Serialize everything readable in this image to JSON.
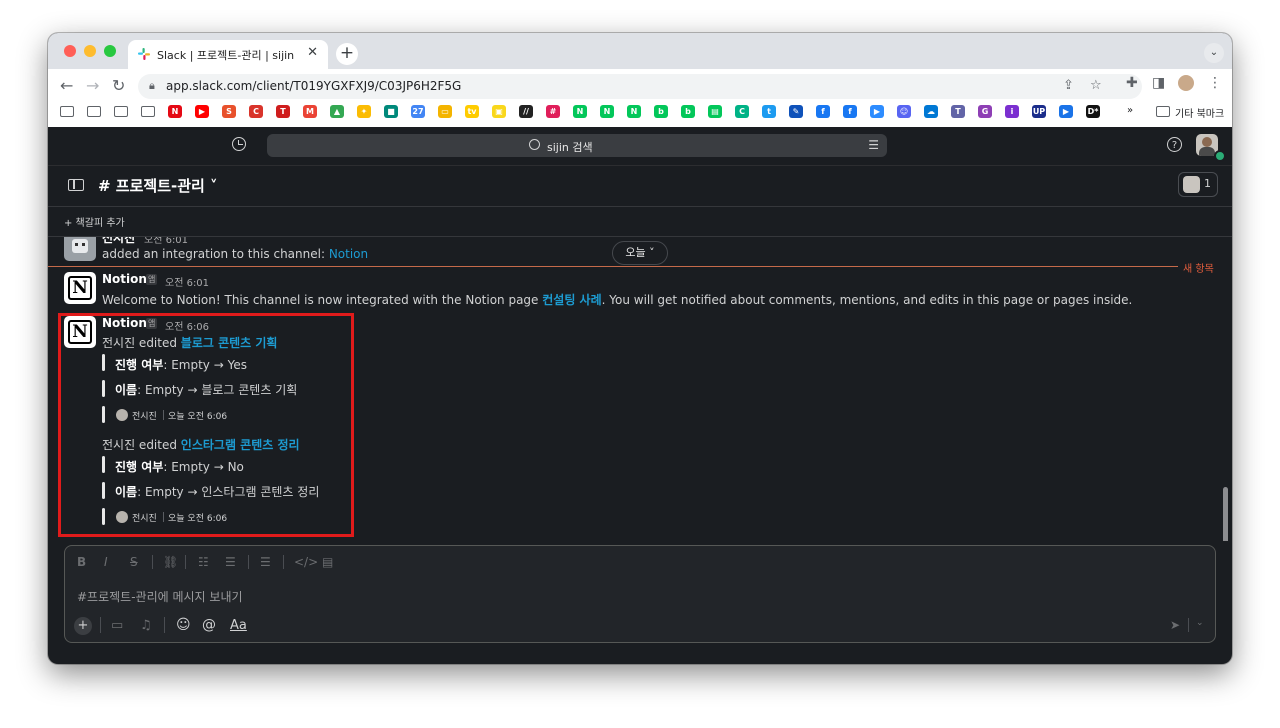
{
  "browser": {
    "tab_title": "Slack | 프로젝트-관리 | sijin",
    "new_tab": "+",
    "url": "app.slack.com/client/T019YGXFXJ9/C03JP6H2F5G",
    "other_bookmarks": "기타 북마크"
  },
  "bookmarks": {
    "items": [
      {
        "icon": "folder-icon"
      },
      {
        "icon": "folder-icon"
      },
      {
        "icon": "folder-icon"
      },
      {
        "icon": "folder-icon"
      },
      {
        "icon": "netflix-icon",
        "color": "#e50914",
        "text": "N"
      },
      {
        "icon": "youtube-icon",
        "color": "#ff0000",
        "text": "▶"
      },
      {
        "icon": "s-icon",
        "color": "#e8512c",
        "text": "S"
      },
      {
        "icon": "c-icon",
        "color": "#d9342b",
        "text": "C"
      },
      {
        "icon": "t-icon",
        "color": "#cf1d1d",
        "text": "T"
      },
      {
        "icon": "gmail-icon",
        "color": "#ea4335",
        "text": "M"
      },
      {
        "icon": "drive-icon",
        "color": "#34a853",
        "text": "▲"
      },
      {
        "icon": "photos-icon",
        "color": "#fbbc04",
        "text": "✦"
      },
      {
        "icon": "meet-icon",
        "color": "#00897b",
        "text": "■"
      },
      {
        "icon": "calendar-icon",
        "color": "#4285f4",
        "text": "27"
      },
      {
        "icon": "slides-icon",
        "color": "#f4b400",
        "text": "▭"
      },
      {
        "icon": "vod-icon",
        "color": "#ffcc00",
        "text": "tv"
      },
      {
        "icon": "tv-icon",
        "color": "#f9d71c",
        "text": "▣"
      },
      {
        "icon": "stripe-icon",
        "color": "#222222",
        "text": "//"
      },
      {
        "icon": "slack-icon",
        "color": "#e01e5a",
        "text": "#"
      },
      {
        "icon": "naver-icon",
        "color": "#03c75a",
        "text": "N"
      },
      {
        "icon": "naver-icon",
        "color": "#03c75a",
        "text": "N"
      },
      {
        "icon": "naver-icon",
        "color": "#03c75a",
        "text": "N"
      },
      {
        "icon": "blog-icon",
        "color": "#03c75a",
        "text": "b"
      },
      {
        "icon": "blog-icon",
        "color": "#03c75a",
        "text": "b"
      },
      {
        "icon": "store-icon",
        "color": "#03c75a",
        "text": "▤"
      },
      {
        "icon": "cafe-icon",
        "color": "#00b386",
        "text": "C"
      },
      {
        "icon": "twitter-icon",
        "color": "#1d9bf0",
        "text": "t"
      },
      {
        "icon": "link-icon",
        "color": "#0f52ba",
        "text": "✎"
      },
      {
        "icon": "facebook-icon",
        "color": "#1877f2",
        "text": "f"
      },
      {
        "icon": "facebook-icon",
        "color": "#1877f2",
        "text": "f"
      },
      {
        "icon": "zoom-icon",
        "color": "#2d8cff",
        "text": "▶"
      },
      {
        "icon": "discord-icon",
        "color": "#5865f2",
        "text": "☺"
      },
      {
        "icon": "onedrive-icon",
        "color": "#0078d4",
        "text": "☁"
      },
      {
        "icon": "teams-icon",
        "color": "#6264a7",
        "text": "T"
      },
      {
        "icon": "g-icon",
        "color": "#8e3fb5",
        "text": "G"
      },
      {
        "icon": "info-icon",
        "color": "#7b2fd0",
        "text": "i"
      },
      {
        "icon": "up-icon",
        "color": "#1b2d8b",
        "text": "UP"
      },
      {
        "icon": "play-icon",
        "color": "#1a73e8",
        "text": "▶"
      },
      {
        "icon": "dstar-icon",
        "color": "#111111",
        "text": "D*"
      }
    ],
    "overflow": "»"
  },
  "slack": {
    "search_placeholder": "sijin 검색",
    "help": "?",
    "channel_name": "# 프로젝트-관리 ˅",
    "member_count": "1",
    "add_bookmark": "+  책갈피 추가",
    "day_divider": "오늘 ˅",
    "new_label": "새 항목",
    "messages": [
      {
        "sender": "전시진",
        "time": "오전 6:01",
        "text_prefix": "added an integration to this channel: ",
        "link": "Notion"
      },
      {
        "sender": "Notion",
        "badge": "앱",
        "time": "오전 6:01",
        "text_prefix": "Welcome to Notion! This channel is now integrated with the Notion page ",
        "link": "컨설팅 사례",
        "text_suffix": ". You will get notified about comments, mentions, and edits in this page or pages inside."
      },
      {
        "sender": "Notion",
        "badge": "앱",
        "time": "오전 6:06",
        "edits": [
          {
            "editor_prefix": "전시진 edited ",
            "page": "블로그 콘텐츠 기획",
            "changes": [
              {
                "field": "진행 여부",
                "value": ": Empty → Yes"
              },
              {
                "field": "이름",
                "value": ": Empty → 블로그 콘텐츠 기획"
              }
            ],
            "footer_name": "전시진",
            "footer_time": "오늘 오전 6:06"
          },
          {
            "editor_prefix": "전시진 edited ",
            "page": "인스타그램 콘텐츠 정리",
            "changes": [
              {
                "field": "진행 여부",
                "value": ": Empty → No"
              },
              {
                "field": "이름",
                "value": ": Empty → 인스타그램 콘텐츠 정리"
              }
            ],
            "footer_name": "전시진",
            "footer_time": "오늘 오전 6:06"
          }
        ]
      }
    ],
    "composer": {
      "placeholder": "#프로젝트-관리에 메시지 보내기",
      "format_aa": "Aa"
    }
  },
  "colors": {
    "slack_bg": "#1a1d21",
    "link": "#1d9bd1",
    "new_divider": "#e25d3d",
    "highlight_box": "#e01b1b"
  }
}
